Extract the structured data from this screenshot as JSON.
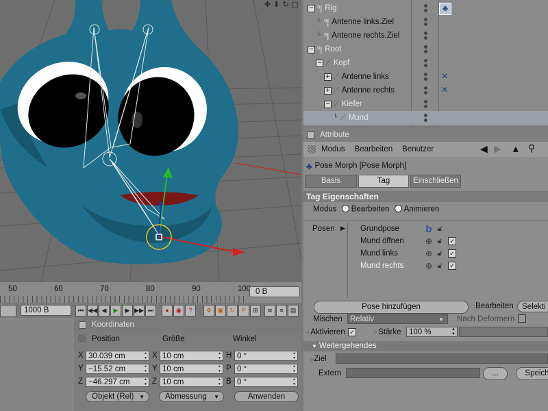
{
  "viewport": {
    "tool_icons": [
      "move-icon",
      "arrow-down-icon",
      "rotate-icon",
      "maximize-icon"
    ],
    "colors": {
      "character": "#1f6f8c",
      "eye_white": "#ffffff",
      "pupil": "#000000",
      "axis_y": "#2db52d",
      "axis_x": "#d22020",
      "grid": "#5a5a5a",
      "background": "#6e6e6e",
      "highlight": "#f0c419"
    }
  },
  "object_manager": {
    "items": [
      {
        "name": "Rig",
        "type": "null",
        "light": true,
        "expand": "−",
        "selected": false,
        "tag": "pose-morph-tag-icon"
      },
      {
        "name": "Antenne links.Ziel",
        "type": "null",
        "light": false,
        "expand": "",
        "selected": false,
        "tag": ""
      },
      {
        "name": "Antenne rechts.Ziel",
        "type": "null",
        "light": false,
        "expand": "",
        "selected": false,
        "tag": ""
      },
      {
        "name": "Root",
        "type": "null",
        "light": true,
        "expand": "−",
        "selected": false,
        "tag": ""
      },
      {
        "name": "Kopf",
        "type": "joint",
        "light": true,
        "expand": "−",
        "selected": false,
        "tag": ""
      },
      {
        "name": "Antenne links",
        "type": "joint",
        "light": false,
        "expand": "+",
        "selected": false,
        "tag": "ik-tag-icon"
      },
      {
        "name": "Antenne rechts",
        "type": "joint",
        "light": false,
        "expand": "+",
        "selected": false,
        "tag": "ik-tag-icon"
      },
      {
        "name": "Kiefer",
        "type": "joint",
        "light": true,
        "expand": "−",
        "selected": false,
        "tag": ""
      },
      {
        "name": "Mund",
        "type": "joint",
        "light": true,
        "expand": "",
        "selected": true,
        "tag": ""
      }
    ]
  },
  "attribute": {
    "title": "Attribute",
    "menu": [
      "Modus",
      "Bearbeiten",
      "Benutzer"
    ],
    "object_name": "Pose Morph [Pose Morph]",
    "tabs": [
      {
        "label": "Basis",
        "active": false
      },
      {
        "label": "Tag",
        "active": true
      },
      {
        "label": "Einschließen",
        "active": false
      }
    ],
    "section": "Tag Eigenschaften",
    "mode_label": "Modus",
    "mode_options": [
      {
        "label": "Bearbeiten",
        "selected": false
      },
      {
        "label": "Animieren",
        "selected": false
      }
    ],
    "poses_label": "Posen",
    "poses": [
      {
        "name": "Grundpose",
        "light": false,
        "icon": "base-pose-icon",
        "check": false
      },
      {
        "name": "Mund öffnen",
        "light": false,
        "icon": "target-icon",
        "check": true
      },
      {
        "name": "Mund links",
        "light": false,
        "icon": "target-icon",
        "check": true
      },
      {
        "name": "Mund rechts",
        "light": true,
        "icon": "target-icon",
        "check": true
      }
    ],
    "add_pose_button": "Pose hinzufügen",
    "edit_label": "Bearbeiten",
    "edit_value": "Selekti",
    "mix_label": "Mischen",
    "mix_value": "Relativ",
    "after_deformers_label": "Nach Deformern",
    "activate_label": "Aktivieren",
    "strength_label": "Stärke",
    "strength_value": "100 %",
    "strength_fraction": 1.0,
    "advanced_section": "Weitergehendes",
    "target_label": "Ziel",
    "extern_label": "Extern",
    "browse_button": "...",
    "save_button": "Speich"
  },
  "timeline": {
    "ticks": [
      "50",
      "60",
      "70",
      "80",
      "90",
      "100"
    ],
    "frame_field": "0 B",
    "end_field": "1000 B"
  },
  "coordinates": {
    "title": "Koordinaten",
    "headers": [
      "Position",
      "Größe",
      "Winkel"
    ],
    "rows": [
      {
        "pos_axis": "X",
        "pos": "30.039 cm",
        "size_axis": "X",
        "size": "10 cm",
        "rot_axis": "H",
        "rot": "0 °"
      },
      {
        "pos_axis": "Y",
        "pos": "−15.52 cm",
        "size_axis": "Y",
        "size": "10 cm",
        "rot_axis": "P",
        "rot": "0 °"
      },
      {
        "pos_axis": "Z",
        "pos": "−46.297 cm",
        "size_axis": "Z",
        "size": "10 cm",
        "rot_axis": "B",
        "rot": "0 °"
      }
    ],
    "mode_dropdown": "Objekt (Rel)",
    "size_dropdown": "Abmessung",
    "apply_button": "Anwenden"
  }
}
